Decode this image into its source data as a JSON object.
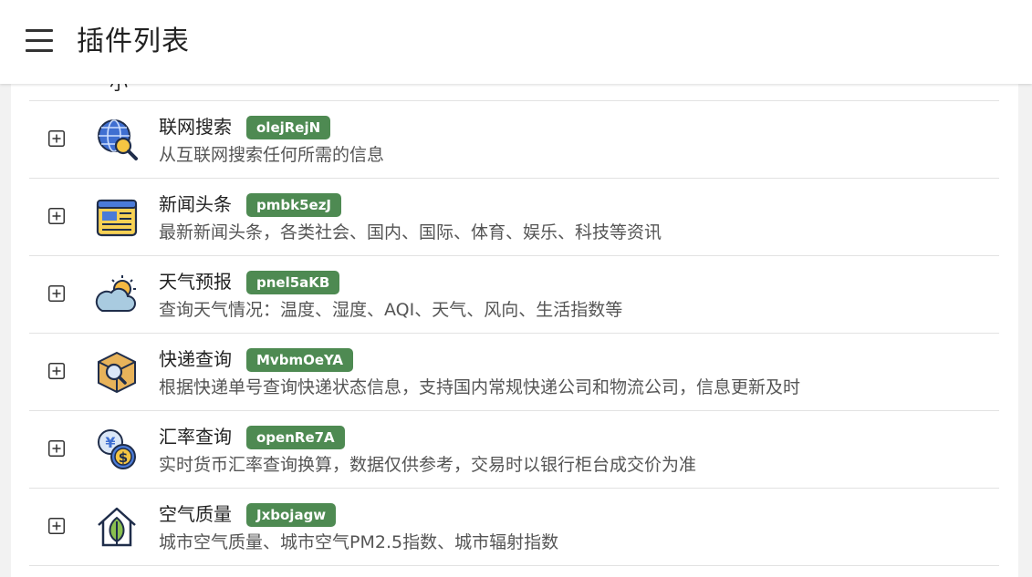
{
  "header": {
    "title": "插件列表"
  },
  "partial_row": {
    "text": "小"
  },
  "plugins": [
    {
      "name": "联网搜索",
      "id": "olejRejN",
      "description": "从互联网搜索任何所需的信息",
      "icon": "web-search-globe-icon"
    },
    {
      "name": "新闻头条",
      "id": "pmbk5ezJ",
      "description": "最新新闻头条，各类社会、国内、国际、体育、娱乐、科技等资讯",
      "icon": "newspaper-icon"
    },
    {
      "name": "天气预报",
      "id": "pnel5aKB",
      "description": "查询天气情况：温度、湿度、AQI、天气、风向、生活指数等",
      "icon": "weather-sun-cloud-icon"
    },
    {
      "name": "快递查询",
      "id": "MvbmOeYA",
      "description": "根据快递单号查询快递状态信息，支持国内常规快递公司和物流公司，信息更新及时",
      "icon": "package-search-icon"
    },
    {
      "name": "汇率查询",
      "id": "openRe7A",
      "description": "实时货币汇率查询换算，数据仅供参考，交易时以银行柜台成交价为准",
      "icon": "currency-exchange-icon"
    },
    {
      "name": "空气质量",
      "id": "Jxbojagw",
      "description": "城市空气质量、城市空气PM2.5指数、城市辐射指数",
      "icon": "air-quality-leaf-icon"
    }
  ],
  "colors": {
    "badge": "#4e8a52",
    "divider": "#e2e2e2",
    "background": "#f2f2f2"
  }
}
